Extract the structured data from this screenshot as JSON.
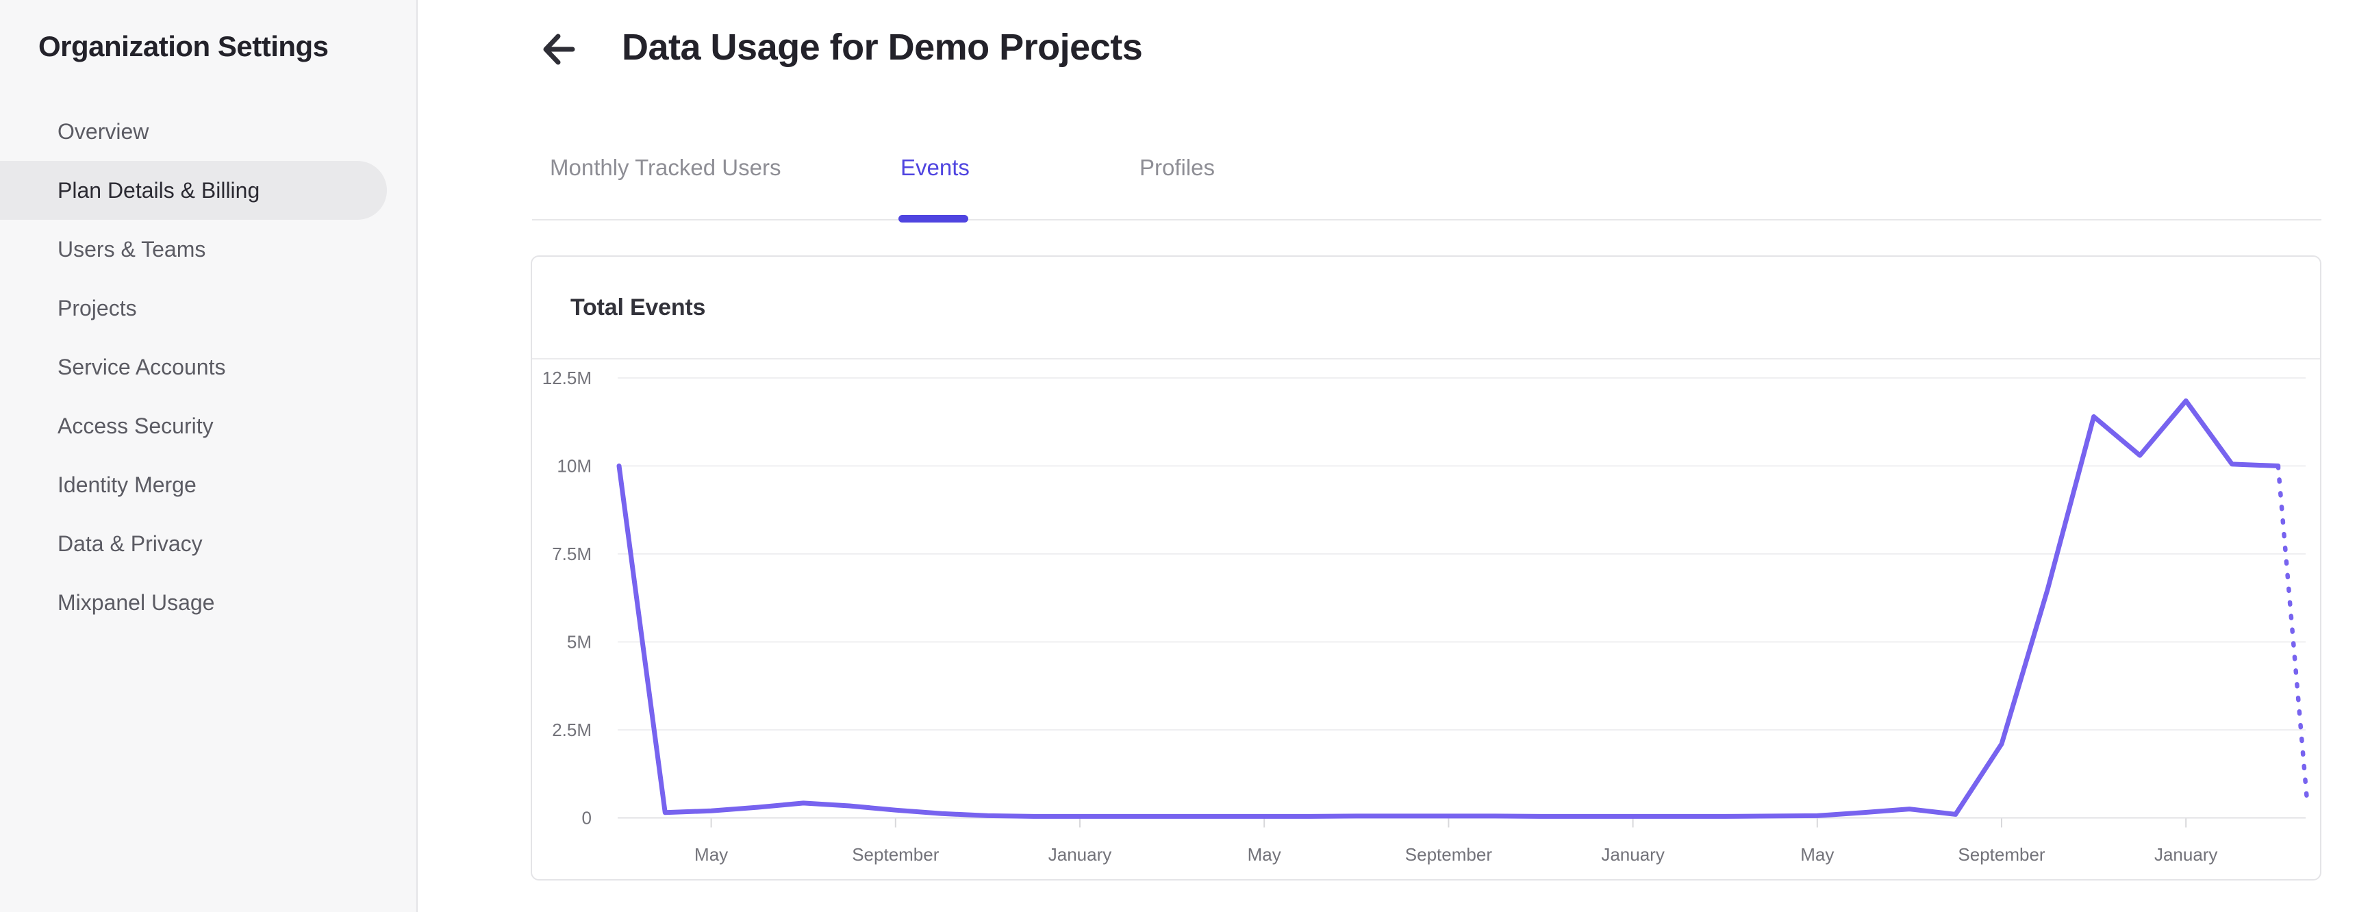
{
  "sidebar": {
    "title": "Organization Settings",
    "items": [
      {
        "label": "Overview",
        "active": false
      },
      {
        "label": "Plan Details & Billing",
        "active": true
      },
      {
        "label": "Users & Teams",
        "active": false
      },
      {
        "label": "Projects",
        "active": false
      },
      {
        "label": "Service Accounts",
        "active": false
      },
      {
        "label": "Access Security",
        "active": false
      },
      {
        "label": "Identity Merge",
        "active": false
      },
      {
        "label": "Data & Privacy",
        "active": false
      },
      {
        "label": "Mixpanel Usage",
        "active": false
      }
    ]
  },
  "header": {
    "title": "Data Usage for Demo Projects"
  },
  "tabs": {
    "items": [
      {
        "label": "Monthly Tracked Users",
        "active": false
      },
      {
        "label": "Events",
        "active": true
      },
      {
        "label": "Profiles",
        "active": false
      }
    ]
  },
  "card": {
    "title": "Total Events"
  },
  "colors": {
    "accent": "#4f44e0",
    "line_color": "#7763ef",
    "grid_color": "#efeff1",
    "axis_color": "#e2e2e5",
    "axis_text_color": "#73737a"
  },
  "chart_data": {
    "type": "line",
    "title": "Total Events",
    "x_granularity": "monthly",
    "x_tick_labels": [
      "May",
      "September",
      "January",
      "May",
      "September",
      "January",
      "May",
      "September",
      "January"
    ],
    "x_label_indices": [
      2,
      6,
      10,
      14,
      18,
      22,
      26,
      30,
      34
    ],
    "y_ticks": [
      {
        "label": "12.5M",
        "value": 12.5
      },
      {
        "label": "10M",
        "value": 10
      },
      {
        "label": "7.5M",
        "value": 7.5
      },
      {
        "label": "5M",
        "value": 5
      },
      {
        "label": "2.5M",
        "value": 2.5
      },
      {
        "label": "0",
        "value": 0
      }
    ],
    "ylim_millions": [
      0,
      12.5
    ],
    "grid": "horizontal",
    "legend": "none",
    "series": [
      {
        "name": "Total Events",
        "unit": "millions of events per month",
        "values_millions": [
          10,
          0.15,
          0.2,
          0.3,
          0.42,
          0.34,
          0.22,
          0.12,
          0.06,
          0.04,
          0.04,
          0.04,
          0.04,
          0.04,
          0.04,
          0.04,
          0.05,
          0.05,
          0.05,
          0.05,
          0.04,
          0.04,
          0.04,
          0.04,
          0.04,
          0.05,
          0.06,
          0.15,
          0.25,
          0.1,
          2.1,
          6.5,
          11.4,
          10.3,
          11.85,
          10.05,
          10.0
        ]
      }
    ],
    "projection": {
      "style": "dotted",
      "end_value_millions": 0.5
    }
  }
}
